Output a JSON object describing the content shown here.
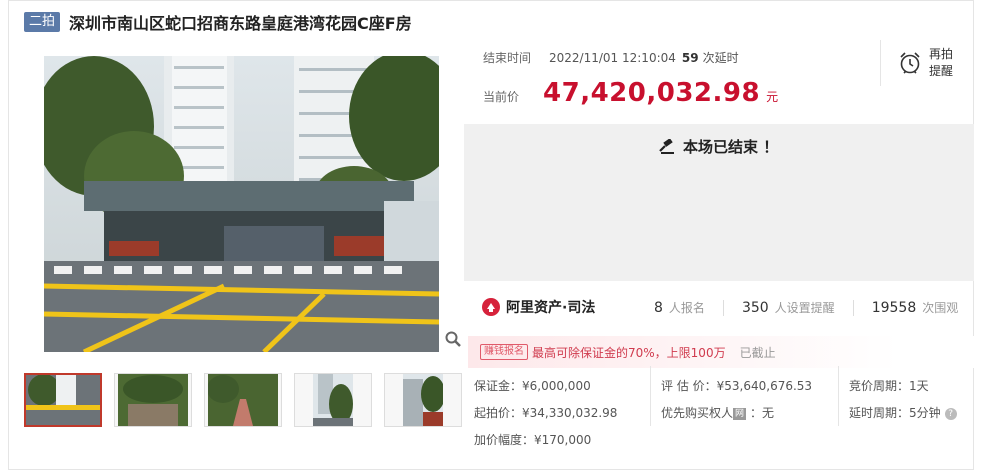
{
  "title": {
    "badge": "二拍",
    "text": "深圳市南山区蛇口招商东路皇庭港湾花园C座F房"
  },
  "auction": {
    "end_label": "结束时间",
    "end_time": "2022/11/01 12:10:04",
    "delay_count": "59",
    "delay_suffix": "次延时",
    "price_label": "当前价",
    "price": "47,420,032.98",
    "price_unit": "元",
    "remind_label": "再拍提醒",
    "ended_text": "本场已结束 ！"
  },
  "platform": {
    "name": "阿里资产·司法",
    "stats": [
      {
        "num": "8",
        "label": "人报名"
      },
      {
        "num": "350",
        "label": "人设置提醒"
      },
      {
        "num": "19558",
        "label": "次围观"
      }
    ]
  },
  "promo": {
    "tag": "赚钱报名",
    "text": "最高可除保证金的70%，上限100万",
    "status": "已截止"
  },
  "details": {
    "deposit": "保证金：¥6,000,000",
    "start_price": "起拍价：¥34,330,032.98",
    "increment": "加价幅度：¥170,000",
    "valuation": "评 估 价：¥53,640,676.53",
    "priority_label": "优先购买权人",
    "priority_badge": "网",
    "priority_value": "：无",
    "cycle": "竞价周期：1天",
    "delay_cycle": "延时周期：5分钟"
  },
  "colors": {
    "price_red": "#c8102e",
    "badge_blue": "#5b7aa8",
    "ended_bg": "#f0f0f0"
  },
  "icons": {
    "zoom": "magnifier-icon",
    "clock": "alarm-clock-icon",
    "gavel": "gavel-icon",
    "logo": "alibaba-logo-icon",
    "help": "question-icon"
  }
}
